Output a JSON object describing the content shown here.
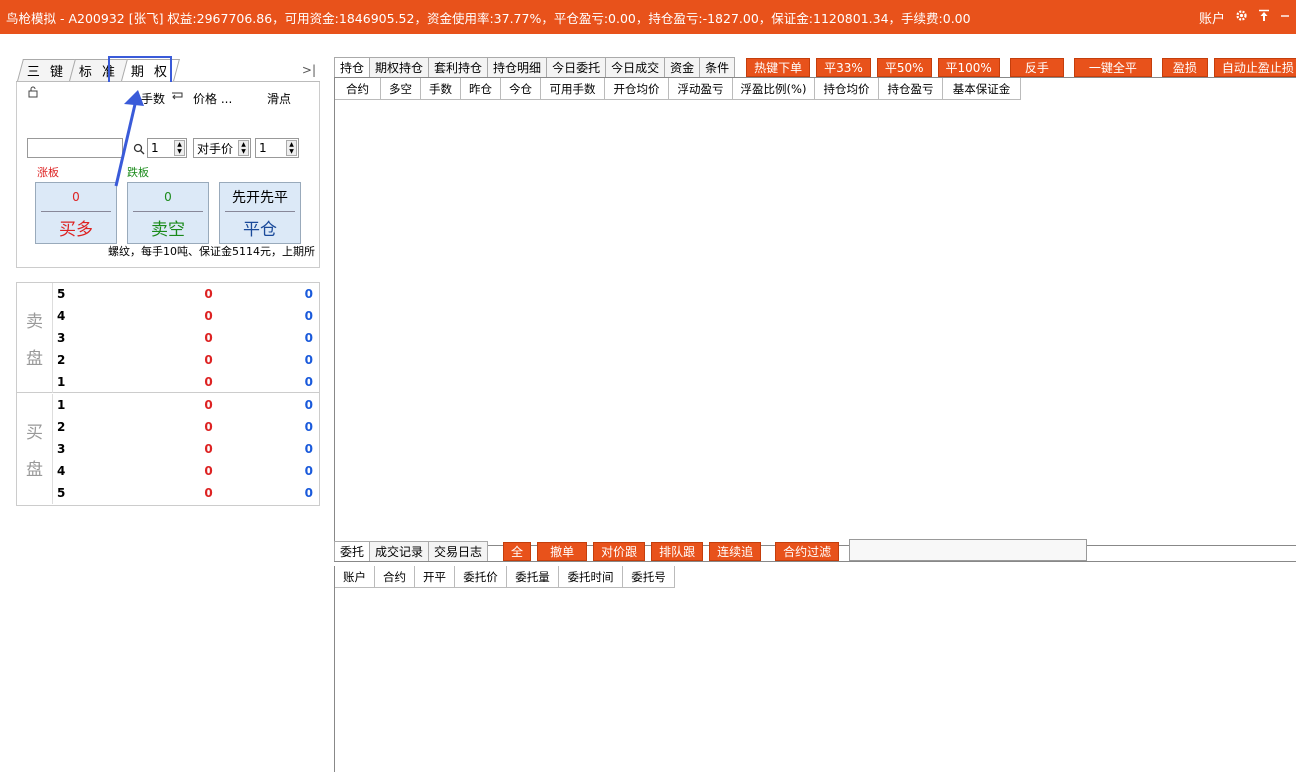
{
  "window": {
    "title": "鸟枪模拟 - A200932 [张飞] 权益:2967706.86，可用资金:1846905.52，资金使用率:37.77%，平仓盈亏:0.00，持仓盈亏:-1827.00，保证金:1120801.34，手续费:0.00",
    "account_label": "账户",
    "icons": [
      "gear-icon",
      "pin-icon",
      "minimize-icon"
    ]
  },
  "left_panel": {
    "tabs": [
      {
        "label": "三 键"
      },
      {
        "label": "标 准"
      },
      {
        "label": "期 权"
      }
    ],
    "active_tab": 2,
    "collapse_label": ">|",
    "order": {
      "qty_label": "手数",
      "price_label": "价格 ...",
      "slip_label": "滑点",
      "qty_value": "1",
      "price_value": "对手价",
      "slip_value": "1",
      "limit_up": "涨板",
      "limit_down": "跌板",
      "buy": {
        "num": "0",
        "label": "买多"
      },
      "sell": {
        "num": "0",
        "label": "卖空"
      },
      "close": {
        "num": "先开先平",
        "label": "平仓"
      },
      "contract_info": "螺纹，每手10吨、保证金5114元，上期所"
    },
    "depth": {
      "ask_label": [
        "卖",
        "盘"
      ],
      "bid_label": [
        "买",
        "盘"
      ],
      "asks": [
        {
          "level": "5",
          "price": "0",
          "vol": "0"
        },
        {
          "level": "4",
          "price": "0",
          "vol": "0"
        },
        {
          "level": "3",
          "price": "0",
          "vol": "0"
        },
        {
          "level": "2",
          "price": "0",
          "vol": "0"
        },
        {
          "level": "1",
          "price": "0",
          "vol": "0"
        }
      ],
      "bids": [
        {
          "level": "1",
          "price": "0",
          "vol": "0"
        },
        {
          "level": "2",
          "price": "0",
          "vol": "0"
        },
        {
          "level": "3",
          "price": "0",
          "vol": "0"
        },
        {
          "level": "4",
          "price": "0",
          "vol": "0"
        },
        {
          "level": "5",
          "price": "0",
          "vol": "0"
        }
      ]
    }
  },
  "positions": {
    "tabs": [
      "持仓",
      "期权持仓",
      "套利持仓",
      "持仓明细",
      "今日委托",
      "今日成交",
      "资金",
      "条件"
    ],
    "buttons": [
      "热键下单",
      "平33%",
      "平50%",
      "平100%",
      "反手",
      "一键全平",
      "盈损",
      "自动止盈止损"
    ],
    "columns": [
      "合约",
      "多空",
      "手数",
      "昨仓",
      "今仓",
      "可用手数",
      "开仓均价",
      "浮动盈亏",
      "浮盈比例(%)",
      "持仓均价",
      "持仓盈亏",
      "基本保证金"
    ]
  },
  "orders": {
    "tabs": [
      "委托",
      "成交记录",
      "交易日志"
    ],
    "buttons": [
      "全",
      "撤单",
      "对价跟",
      "排队跟",
      "连续追",
      "合约过滤"
    ],
    "filter_value": "",
    "columns": [
      "账户",
      "合约",
      "开平",
      "委托价",
      "委托量",
      "委托时间",
      "委托号"
    ]
  },
  "colors": {
    "accent": "#e8521b",
    "annotation": "#3a5bd9",
    "price_red": "#d22222",
    "volume_blue": "#1a5adb"
  }
}
